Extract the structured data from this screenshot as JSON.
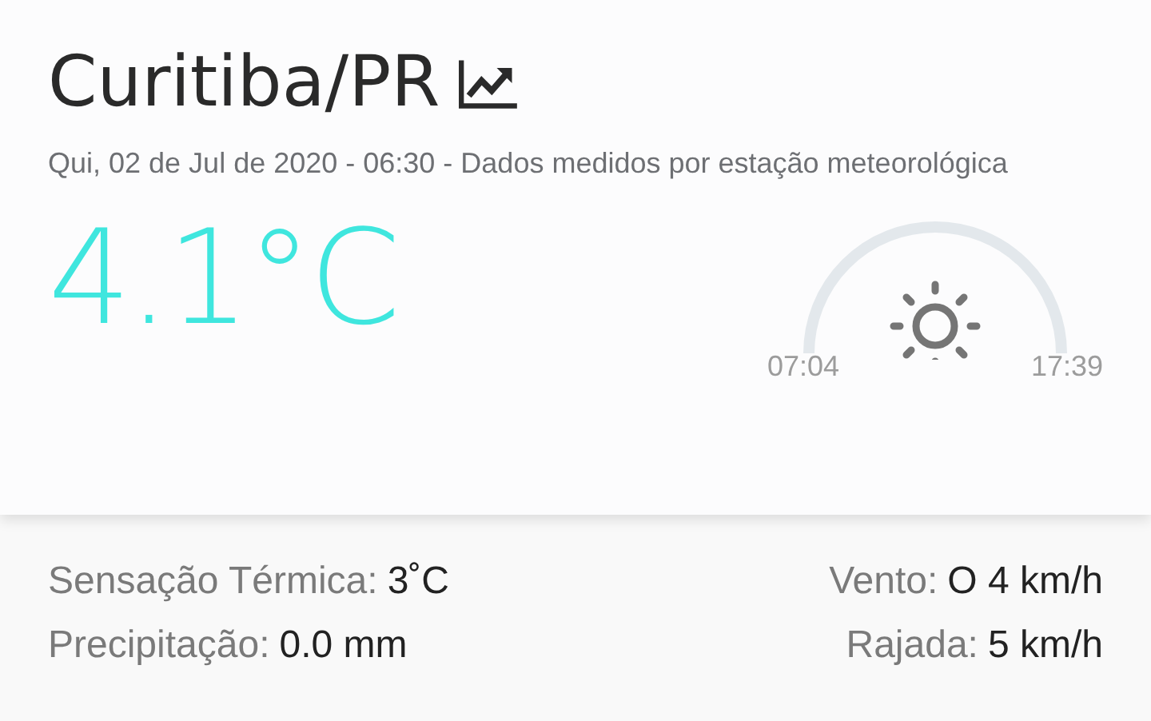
{
  "city": "Curitiba/PR",
  "subtitle": "Qui, 02 de Jul de 2020 - 06:30 - Dados medidos por estação meteorológica",
  "temperature": "4.1°C",
  "sunrise": "07:04",
  "sunset": "17:39",
  "stats_left": [
    {
      "label": "Sensação Térmica:",
      "value": "3˚C"
    },
    {
      "label": "Precipitação:",
      "value": "0.0 mm"
    }
  ],
  "stats_right": [
    {
      "label": "Vento:",
      "value": "O 4 km/h"
    },
    {
      "label": "Rajada:",
      "value": "5 km/h"
    }
  ]
}
